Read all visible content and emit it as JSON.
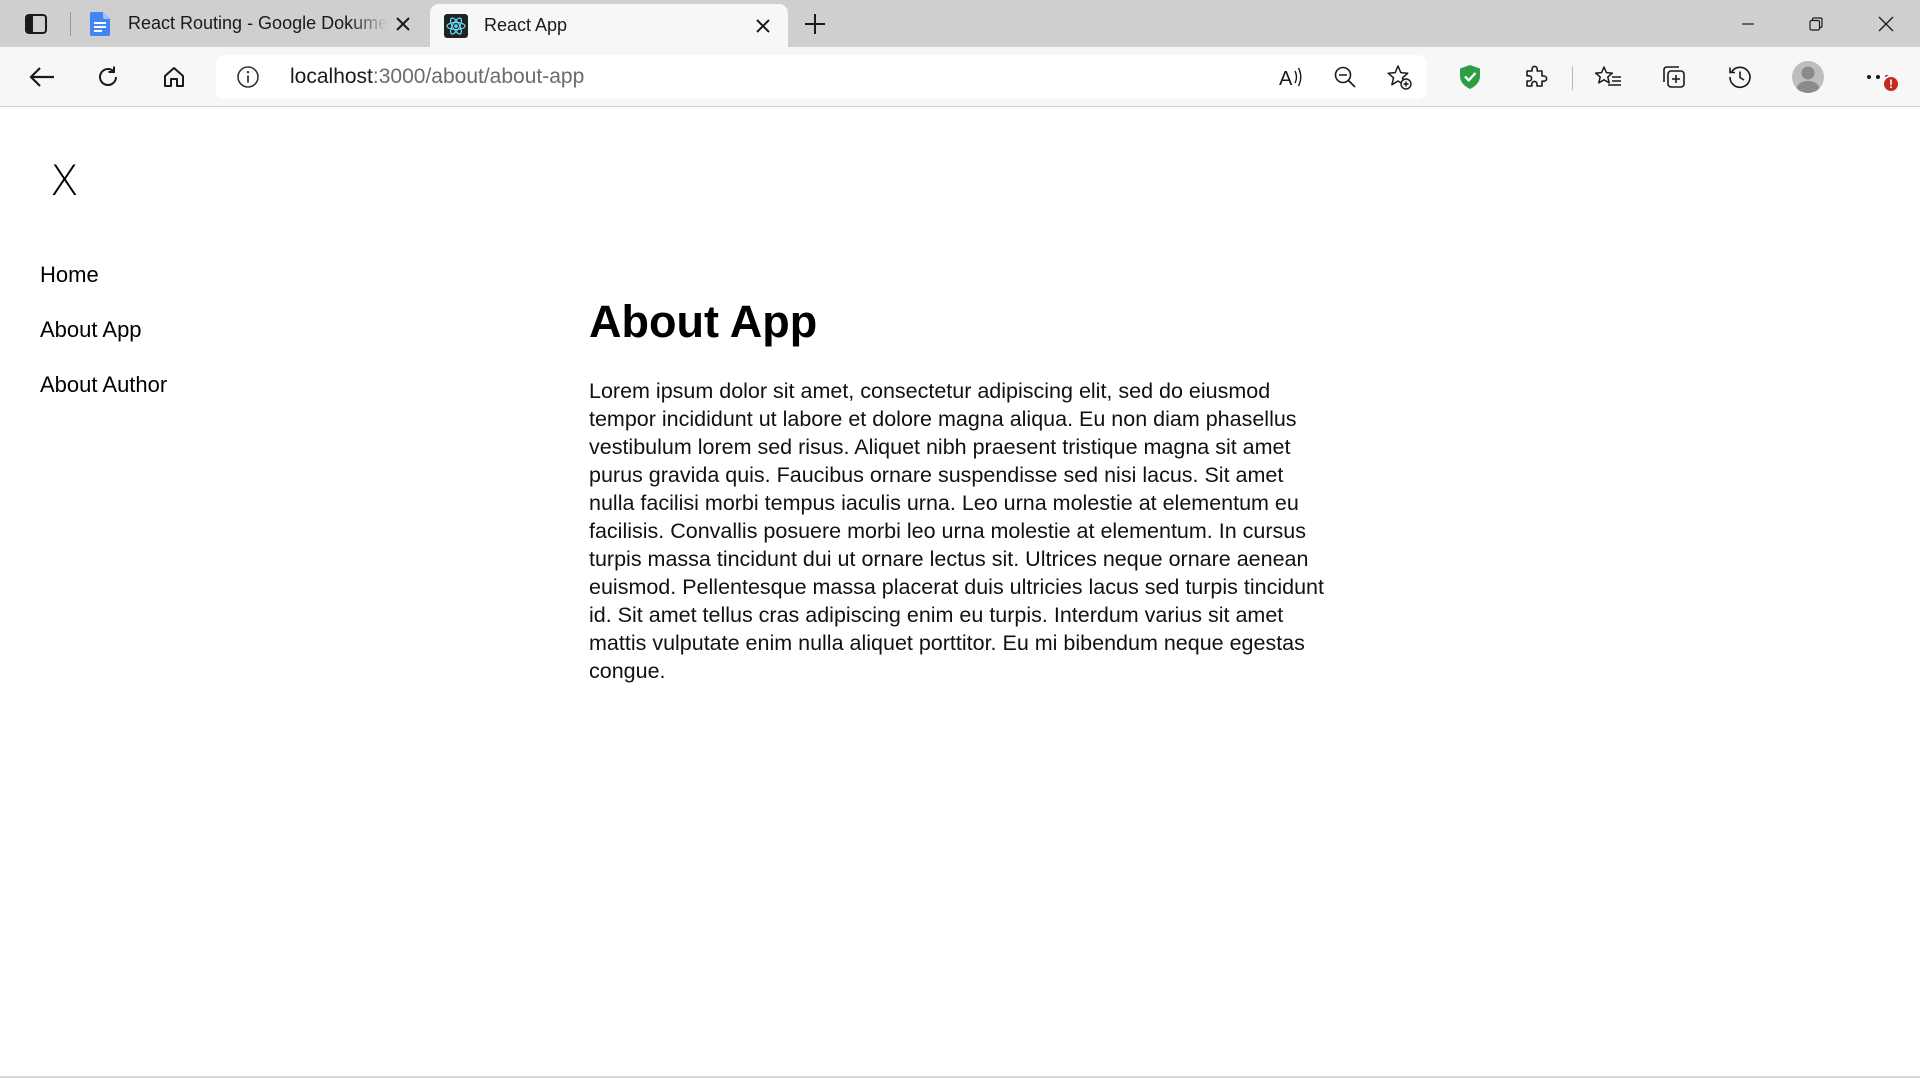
{
  "browser": {
    "tabs": [
      {
        "title": "React Routing - Google Dokumente",
        "favicon": "google-docs-icon",
        "active": false
      },
      {
        "title": "React App",
        "favicon": "react-icon",
        "active": true
      }
    ],
    "address": {
      "host": "localhost",
      "path": ":3000/about/about-app"
    },
    "notification_badge": "!",
    "colors": {
      "tabstrip": "#cfcfcf",
      "toolbar": "#f7f7f7",
      "docs_blue": "#4285f4",
      "react_cyan": "#61dafb",
      "shield_green": "#2e9e44",
      "badge_red": "#c42b1c"
    }
  },
  "app": {
    "close_symbol": "X",
    "nav": [
      {
        "label": "Home"
      },
      {
        "label": "About App"
      },
      {
        "label": "About Author"
      }
    ],
    "heading": "About App",
    "body": "Lorem ipsum dolor sit amet, consectetur adipiscing elit, sed do eiusmod tempor incididunt ut labore et dolore magna aliqua. Eu non diam phasellus vestibulum lorem sed risus. Aliquet nibh praesent tristique magna sit amet purus gravida quis. Faucibus ornare suspendisse sed nisi lacus. Sit amet nulla facilisi morbi tempus iaculis urna. Leo urna molestie at elementum eu facilisis. Convallis posuere morbi leo urna molestie at elementum. In cursus turpis massa tincidunt dui ut ornare lectus sit. Ultrices neque ornare aenean euismod. Pellentesque massa placerat duis ultricies lacus sed turpis tincidunt id. Sit amet tellus cras adipiscing enim eu turpis. Interdum varius sit amet mattis vulputate enim nulla aliquet porttitor. Eu mi bibendum neque egestas congue."
  }
}
